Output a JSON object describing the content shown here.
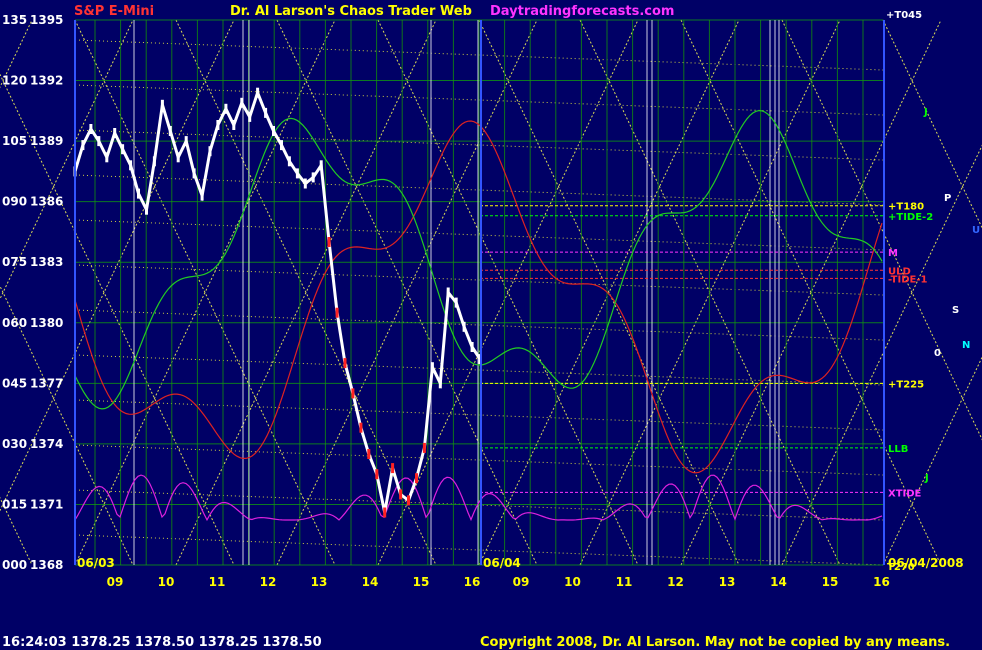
{
  "header": {
    "instrument": "S&P E-Mini",
    "title": "Dr. Al Larson's Chaos Trader Web",
    "site": "Daytradingforecasts.com",
    "corner_tag": "+T045",
    "colors": {
      "instrument": "#ff3333",
      "title": "#ffff00",
      "site": "#ff33ff"
    }
  },
  "footer": {
    "quote": "16:24:03  1378.25  1378.50  1378.25  1378.50",
    "copyright": "Copyright 2008, Dr. Al Larson. May not be copied by any means."
  },
  "chart_data": {
    "type": "line",
    "title": "S&P E-Mini",
    "y_ticks": [
      {
        "code": "000",
        "price": "1368"
      },
      {
        "code": "015",
        "price": "1371"
      },
      {
        "code": "030",
        "price": "1374"
      },
      {
        "code": "045",
        "price": "1377"
      },
      {
        "code": "060",
        "price": "1380"
      },
      {
        "code": "075",
        "price": "1383"
      },
      {
        "code": "090",
        "price": "1386"
      },
      {
        "code": "105",
        "price": "1389"
      },
      {
        "code": "120",
        "price": "1392"
      },
      {
        "code": "135",
        "price": "1395"
      }
    ],
    "ylim": [
      1368,
      1395
    ],
    "x_ticks": [
      "09",
      "10",
      "11",
      "12",
      "13",
      "14",
      "15",
      "16",
      "09",
      "10",
      "11",
      "12",
      "13",
      "14",
      "15",
      "16"
    ],
    "date_labels": {
      "start": "06/03",
      "mid": "06/04",
      "end": "06/04/2008"
    },
    "price_series": [
      [
        0,
        1387.5
      ],
      [
        0.2,
        1388.8
      ],
      [
        0.4,
        1389.6
      ],
      [
        0.6,
        1389.0
      ],
      [
        0.8,
        1388.2
      ],
      [
        1.0,
        1389.4
      ],
      [
        1.2,
        1388.6
      ],
      [
        1.4,
        1387.8
      ],
      [
        1.6,
        1386.4
      ],
      [
        1.8,
        1385.6
      ],
      [
        2.0,
        1388.0
      ],
      [
        2.2,
        1390.8
      ],
      [
        2.4,
        1389.5
      ],
      [
        2.6,
        1388.2
      ],
      [
        2.8,
        1389.0
      ],
      [
        3.0,
        1387.4
      ],
      [
        3.2,
        1386.3
      ],
      [
        3.4,
        1388.5
      ],
      [
        3.6,
        1389.8
      ],
      [
        3.8,
        1390.6
      ],
      [
        4.0,
        1389.8
      ],
      [
        4.2,
        1390.9
      ],
      [
        4.4,
        1390.2
      ],
      [
        4.6,
        1391.4
      ],
      [
        4.8,
        1390.4
      ],
      [
        5.0,
        1389.5
      ],
      [
        5.2,
        1388.8
      ],
      [
        5.4,
        1388.0
      ],
      [
        5.6,
        1387.4
      ],
      [
        5.8,
        1386.9
      ],
      [
        6.0,
        1387.2
      ],
      [
        6.2,
        1387.8
      ],
      [
        6.4,
        1384.0
      ],
      [
        6.6,
        1380.5
      ],
      [
        6.8,
        1378.0
      ],
      [
        7.0,
        1376.5
      ],
      [
        7.2,
        1374.8
      ],
      [
        7.4,
        1373.5
      ],
      [
        7.6,
        1372.5
      ],
      [
        7.8,
        1370.6
      ],
      [
        8.0,
        1372.8
      ],
      [
        8.2,
        1371.5
      ],
      [
        8.4,
        1371.2
      ],
      [
        8.6,
        1372.3
      ],
      [
        8.8,
        1373.8
      ],
      [
        9.0,
        1377.8
      ],
      [
        9.2,
        1377.0
      ],
      [
        9.4,
        1381.5
      ],
      [
        9.6,
        1381.0
      ],
      [
        9.8,
        1379.8
      ],
      [
        10.0,
        1378.8
      ],
      [
        10.2,
        1378.2
      ]
    ],
    "levels": [
      {
        "label": "+T180",
        "price": 1385.8,
        "color": "#ffff00"
      },
      {
        "label": "+TIDE-2",
        "price": 1385.3,
        "color": "#00ff00"
      },
      {
        "label": "M",
        "price": 1383.5,
        "color": "#ff33ff"
      },
      {
        "label": "ULD",
        "price": 1382.6,
        "color": "#ff3333"
      },
      {
        "label": "-TIDE-1",
        "price": 1382.2,
        "color": "#ff3333"
      },
      {
        "label": "+T225",
        "price": 1377.0,
        "color": "#ffff00"
      },
      {
        "label": "LLB",
        "price": 1373.8,
        "color": "#00ff00"
      },
      {
        "label": "XTIDE",
        "price": 1371.6,
        "color": "#ff33ff"
      }
    ],
    "bottom_right_tag": "T270",
    "planet_labels_right": [
      {
        "text": "P",
        "color": "#ffffff"
      },
      {
        "text": "U",
        "color": "#3366ff"
      },
      {
        "text": "S",
        "color": "#ffffff"
      },
      {
        "text": "N",
        "color": "#00ffff"
      },
      {
        "text": "0",
        "color": "#ffffff"
      },
      {
        "text": "J",
        "color": "#00ff00"
      },
      {
        "text": "J",
        "color": "#00ff00"
      }
    ],
    "grid": true
  }
}
